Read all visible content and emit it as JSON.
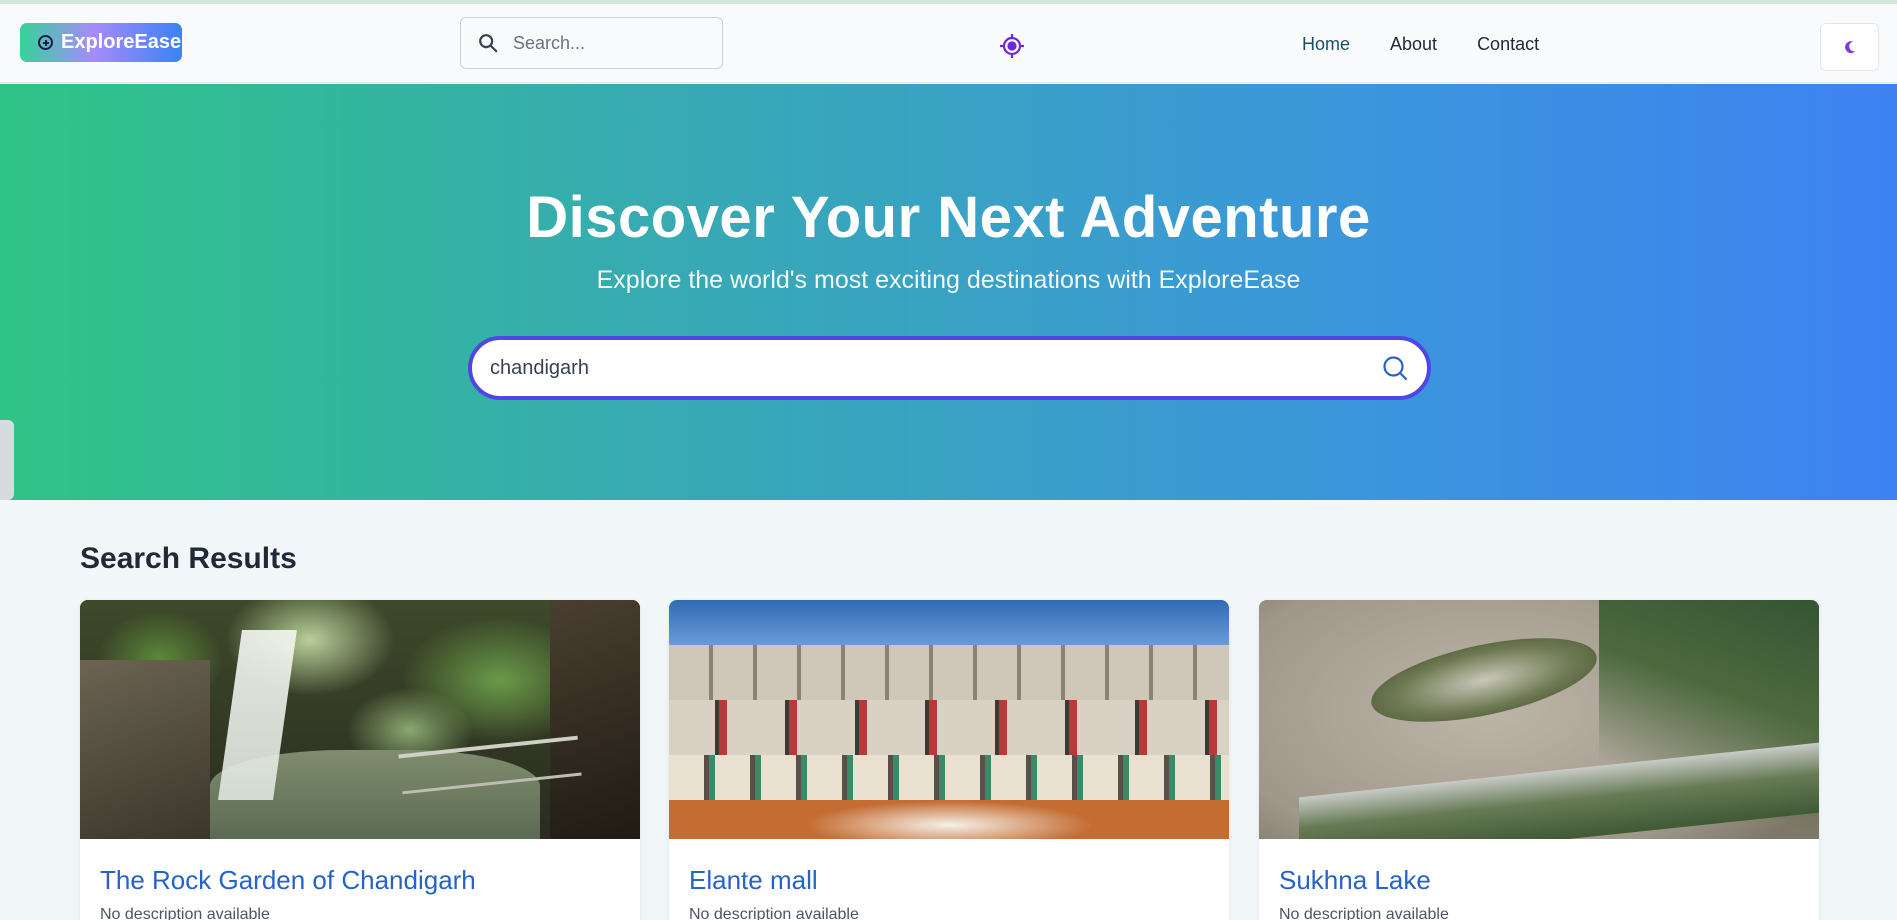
{
  "app": {
    "name": "ExploreEase"
  },
  "header": {
    "search_placeholder": "Search...",
    "nav": [
      {
        "label": "Home",
        "active": true
      },
      {
        "label": "About",
        "active": false
      },
      {
        "label": "Contact",
        "active": false
      }
    ],
    "icons": {
      "search": "search-icon",
      "locate": "locate-icon",
      "theme": "moon-icon"
    }
  },
  "hero": {
    "title": "Discover Your Next Adventure",
    "subtitle": "Explore the world's most exciting destinations with ExploreEase",
    "search_value": "chandigarh"
  },
  "results": {
    "heading": "Search Results",
    "items": [
      {
        "title": "The Rock Garden of Chandigarh",
        "description": "No description available"
      },
      {
        "title": "Elante mall",
        "description": "No description available"
      },
      {
        "title": "Sukhna Lake",
        "description": "No description available"
      }
    ]
  },
  "colors": {
    "accent": "#4f46e5",
    "link": "#2563c9",
    "hero_gradient_start": "#2fc486",
    "hero_gradient_end": "#3d82f2",
    "theme_icon": "#7c3aed"
  }
}
